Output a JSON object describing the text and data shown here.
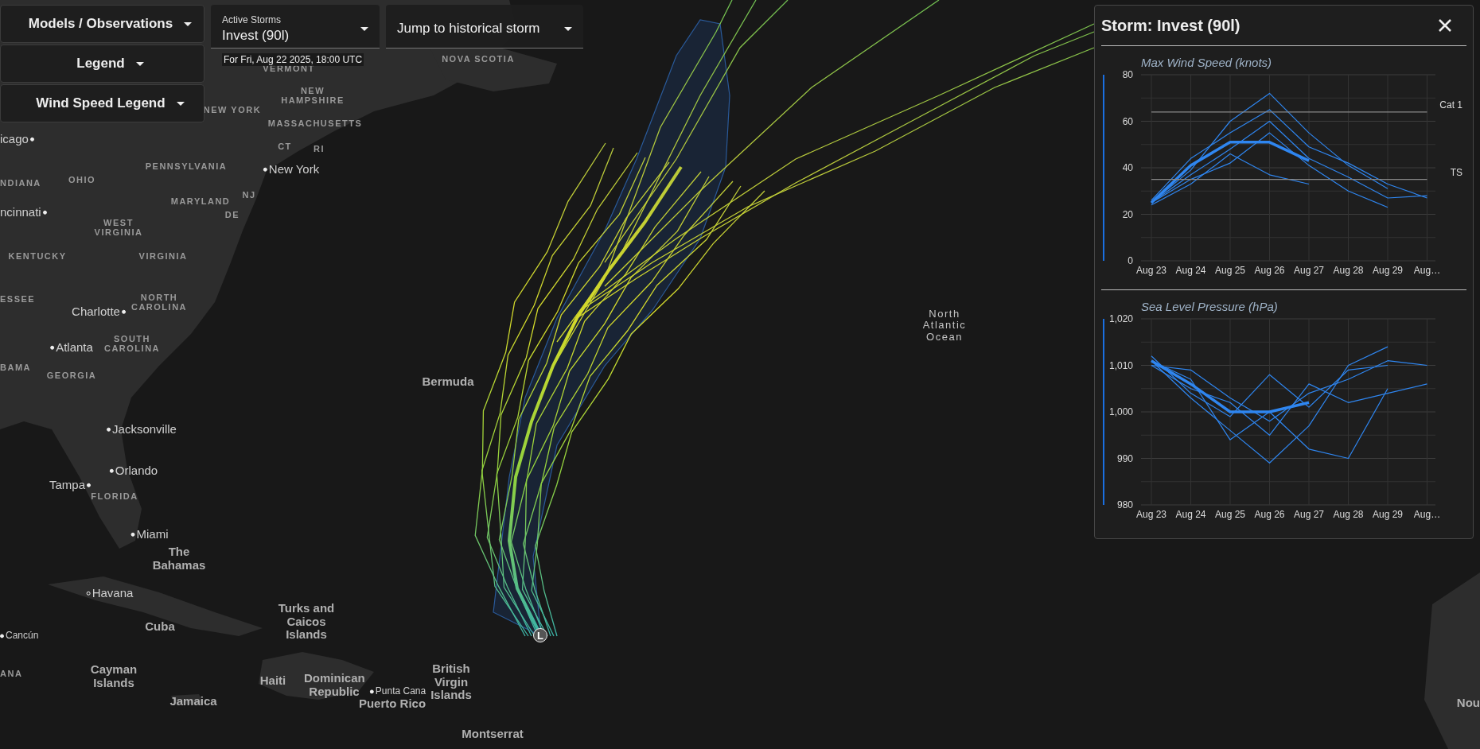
{
  "controls": {
    "menus": [
      {
        "label": "Models / Observations"
      },
      {
        "label": "Legend"
      },
      {
        "label": "Wind Speed Legend"
      }
    ]
  },
  "active_storm": {
    "label": "Active Storms",
    "value": "Invest (90l)",
    "timestamp": "For Fri, Aug 22 2025, 18:00 UTC"
  },
  "historical_storm": {
    "label": "Jump to historical storm"
  },
  "map": {
    "storm_marker": "L",
    "labels": [
      {
        "text": "VERMONT",
        "kind": "region"
      },
      {
        "text": "NOVA SCOTIA",
        "kind": "region"
      },
      {
        "text": "NEW HAMPSHIRE",
        "kind": "region"
      },
      {
        "text": "NEW YORK",
        "kind": "region"
      },
      {
        "text": "MASSACHUSETTS",
        "kind": "region"
      },
      {
        "text": "CT",
        "kind": "region"
      },
      {
        "text": "RI",
        "kind": "region"
      },
      {
        "text": "icago",
        "kind": "city"
      },
      {
        "text": "PENNSYLVANIA",
        "kind": "region"
      },
      {
        "text": "New York",
        "kind": "city"
      },
      {
        "text": "NDIANA",
        "kind": "region"
      },
      {
        "text": "OHIO",
        "kind": "region"
      },
      {
        "text": "NJ",
        "kind": "region"
      },
      {
        "text": "MARYLAND",
        "kind": "region"
      },
      {
        "text": "DE",
        "kind": "region"
      },
      {
        "text": "ncinnati",
        "kind": "city"
      },
      {
        "text": "WEST VIRGINIA",
        "kind": "region"
      },
      {
        "text": "KENTUCKY",
        "kind": "region"
      },
      {
        "text": "VIRGINIA",
        "kind": "region"
      },
      {
        "text": "ESSEE",
        "kind": "region"
      },
      {
        "text": "NORTH CAROLINA",
        "kind": "region"
      },
      {
        "text": "Charlotte",
        "kind": "city"
      },
      {
        "text": "Atlanta",
        "kind": "city"
      },
      {
        "text": "SOUTH CAROLINA",
        "kind": "region"
      },
      {
        "text": "BAMA",
        "kind": "region"
      },
      {
        "text": "GEORGIA",
        "kind": "region"
      },
      {
        "text": "Jacksonville",
        "kind": "city"
      },
      {
        "text": "Orlando",
        "kind": "city"
      },
      {
        "text": "Tampa",
        "kind": "city"
      },
      {
        "text": "FLORIDA",
        "kind": "region"
      },
      {
        "text": "Miami",
        "kind": "city"
      },
      {
        "text": "The Bahamas",
        "kind": "place"
      },
      {
        "text": "Havana",
        "kind": "city"
      },
      {
        "text": "Cuba",
        "kind": "place"
      },
      {
        "text": "Cancún",
        "kind": "small_city"
      },
      {
        "text": "ANA",
        "kind": "region"
      },
      {
        "text": "Cayman Islands",
        "kind": "place"
      },
      {
        "text": "Jamaica",
        "kind": "place"
      },
      {
        "text": "Haiti",
        "kind": "place"
      },
      {
        "text": "Dominican Republic",
        "kind": "place"
      },
      {
        "text": "Punta Cana",
        "kind": "small_city"
      },
      {
        "text": "Puerto Rico",
        "kind": "place"
      },
      {
        "text": "British Virgin Islands",
        "kind": "place"
      },
      {
        "text": "Turks and Caicos Islands",
        "kind": "place"
      },
      {
        "text": "Montserrat",
        "kind": "place"
      },
      {
        "text": "Bermuda",
        "kind": "place"
      },
      {
        "text": "North Atlantic Ocean",
        "kind": "ocean"
      },
      {
        "text": "Nou",
        "kind": "place"
      }
    ]
  },
  "storm_panel": {
    "title": "Storm: Invest (90l)",
    "charts": [
      {
        "chart_data": {
          "type": "line",
          "title": "Max Wind Speed (knots)",
          "categories": [
            "Aug 23",
            "Aug 24",
            "Aug 25",
            "Aug 26",
            "Aug 27",
            "Aug 28",
            "Aug 29",
            "Aug…"
          ],
          "ylim": [
            0,
            80
          ],
          "yticks": [
            0,
            20,
            40,
            60,
            80
          ],
          "grid": true,
          "series": [
            {
              "color": "#2f86f0",
              "values": [
                25,
                41,
                51,
                51,
                43,
                null,
                null,
                null
              ]
            },
            {
              "color": "#2f86f0",
              "values": [
                25,
                39,
                60,
                72,
                55,
                41,
                31,
                null
              ]
            },
            {
              "color": "#2f86f0",
              "values": [
                26,
                44,
                55,
                65,
                49,
                42,
                33,
                27
              ]
            },
            {
              "color": "#2f86f0",
              "values": [
                25,
                37,
                48,
                60,
                44,
                36,
                27,
                28
              ]
            },
            {
              "color": "#2f86f0",
              "values": [
                24,
                33,
                46,
                37,
                33,
                null,
                null,
                null
              ]
            },
            {
              "color": "#2f86f0",
              "values": [
                25,
                35,
                42,
                55,
                41,
                30,
                23,
                null
              ]
            },
            {
              "name": "Cat 1",
              "color": "#888888",
              "values": [
                64,
                64,
                64,
                64,
                64,
                64,
                64,
                64
              ]
            },
            {
              "name": "TS",
              "color": "#888888",
              "values": [
                35,
                35,
                35,
                35,
                35,
                35,
                35,
                35
              ]
            }
          ]
        }
      },
      {
        "chart_data": {
          "type": "line",
          "title": "Sea Level Pressure (hPa)",
          "categories": [
            "Aug 23",
            "Aug 24",
            "Aug 25",
            "Aug 26",
            "Aug 27",
            "Aug 28",
            "Aug 29",
            "Aug…"
          ],
          "ylim": [
            980,
            1020
          ],
          "yticks": [
            {
              "value": 980,
              "label": "980"
            },
            {
              "value": 990,
              "label": "990"
            },
            {
              "value": 1000,
              "label": "1,000"
            },
            {
              "value": 1010,
              "label": "1,010"
            },
            {
              "value": 1020,
              "label": "1,020"
            }
          ],
          "grid": true,
          "series": [
            {
              "color": "#2f86f0",
              "values": [
                1011,
                1006,
                1000,
                1000,
                1002,
                null,
                null,
                null
              ]
            },
            {
              "color": "#2f86f0",
              "values": [
                1011,
                1003,
                996,
                989,
                997,
                1010,
                1014,
                null
              ]
            },
            {
              "color": "#2f86f0",
              "values": [
                1010,
                1005,
                1002,
                995,
                1006,
                1002,
                1004,
                1006
              ]
            },
            {
              "color": "#2f86f0",
              "values": [
                1011,
                1007,
                994,
                1000,
                992,
                990,
                1005,
                null
              ]
            },
            {
              "color": "#2f86f0",
              "values": [
                1012,
                1004,
                999,
                1008,
                1001,
                1009,
                1010,
                null
              ]
            },
            {
              "color": "#2f86f0",
              "values": [
                1010,
                1009,
                1003,
                998,
                1004,
                1007,
                1011,
                1010
              ]
            }
          ]
        }
      }
    ]
  }
}
